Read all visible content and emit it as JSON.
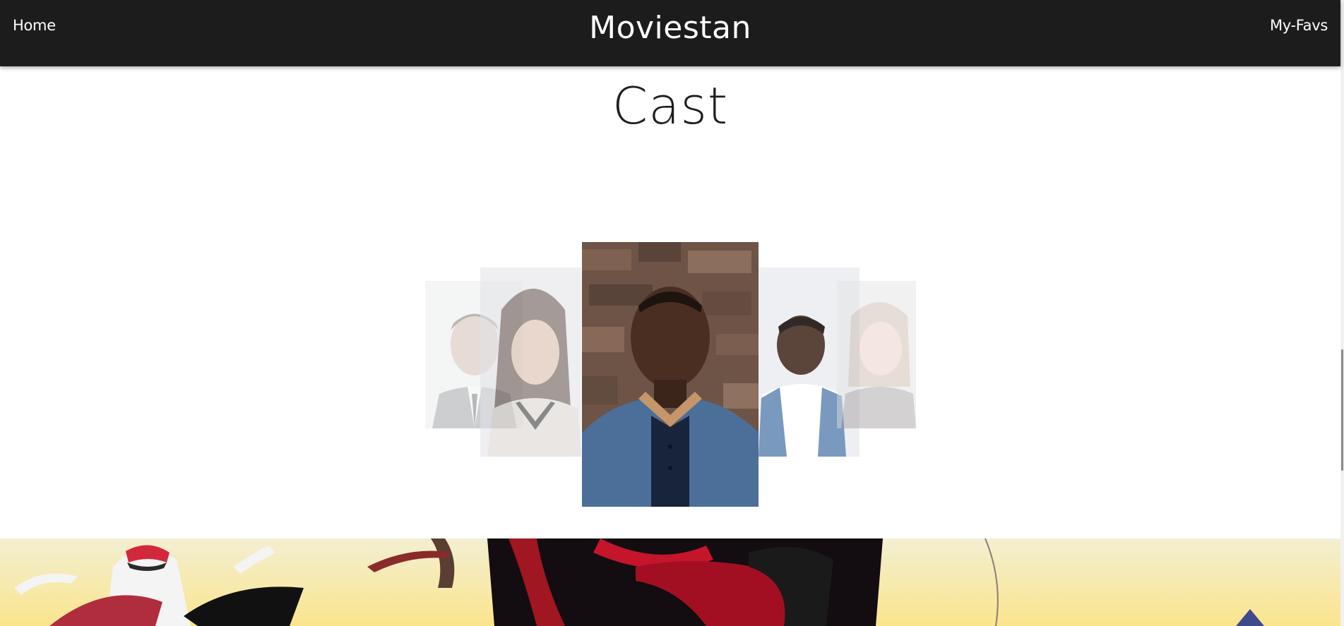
{
  "navbar": {
    "home_label": "Home",
    "brand": "Moviestan",
    "favs_label": "My-Favs"
  },
  "cast_section": {
    "title": "Cast"
  },
  "colors": {
    "navbar_bg": "#1c1c1c",
    "page_bg": "#ffffff",
    "title_text": "#1e1e1e",
    "banner_bg": "#f9e79a"
  }
}
